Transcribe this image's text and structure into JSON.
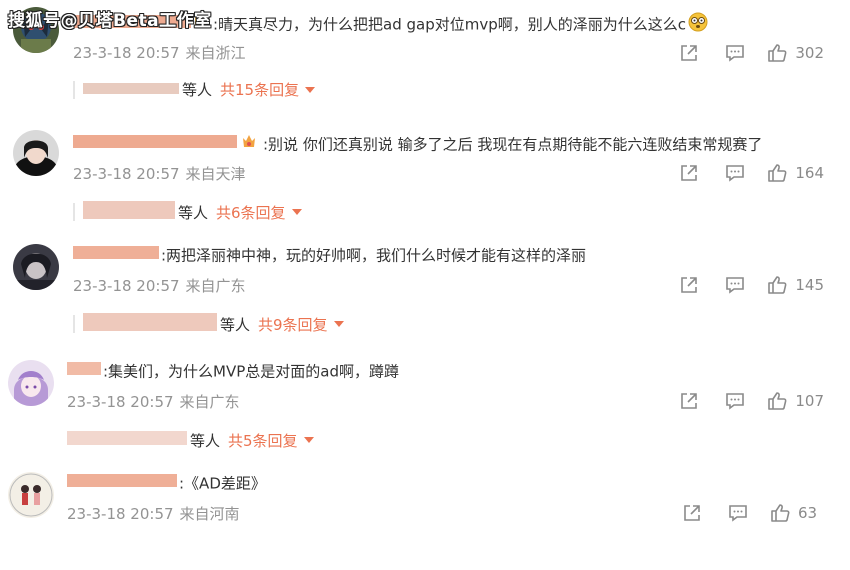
{
  "watermark": "搜狐号@贝塔Beta工作室",
  "comments": [
    {
      "content": ":晴天真尽力，为什么把把ad gap对位mvp啊，别人的泽丽为什么这么c",
      "emoji": "flushed-face",
      "date": "23-3-18 20:57",
      "location": "来自浙江",
      "likes": "302",
      "reply_users_suffix": "等人",
      "reply_more": "共15条回复"
    },
    {
      "content": ":别说 你们还真别说 输多了之后 我现在有点期待能不能六连败结束常规赛了",
      "badge": "crown",
      "date": "23-3-18 20:57",
      "location": "来自天津",
      "likes": "164",
      "reply_users_suffix": "等人",
      "reply_more": "共6条回复"
    },
    {
      "content": ":两把泽丽神中神，玩的好帅啊，我们什么时候才能有这样的泽丽",
      "date": "23-3-18 20:57",
      "location": "来自广东",
      "likes": "145",
      "reply_users_suffix": "等人",
      "reply_more": "共9条回复"
    },
    {
      "content": ":集美们，为什么MVP总是对面的ad啊，蹲蹲",
      "date": "23-3-18 20:57",
      "location": "来自广东",
      "likes": "107",
      "reply_users_suffix": "等人",
      "reply_more": "共5条回复"
    },
    {
      "content": ":《AD差距》",
      "date": "23-3-18 20:57",
      "location": "来自河南",
      "likes": "63"
    }
  ],
  "icons": {
    "share": "share-icon",
    "reply": "comment-icon",
    "like": "thumbs-up-icon"
  },
  "colors": {
    "accent": "#eb7350",
    "meta": "#939393",
    "text": "#333333"
  }
}
